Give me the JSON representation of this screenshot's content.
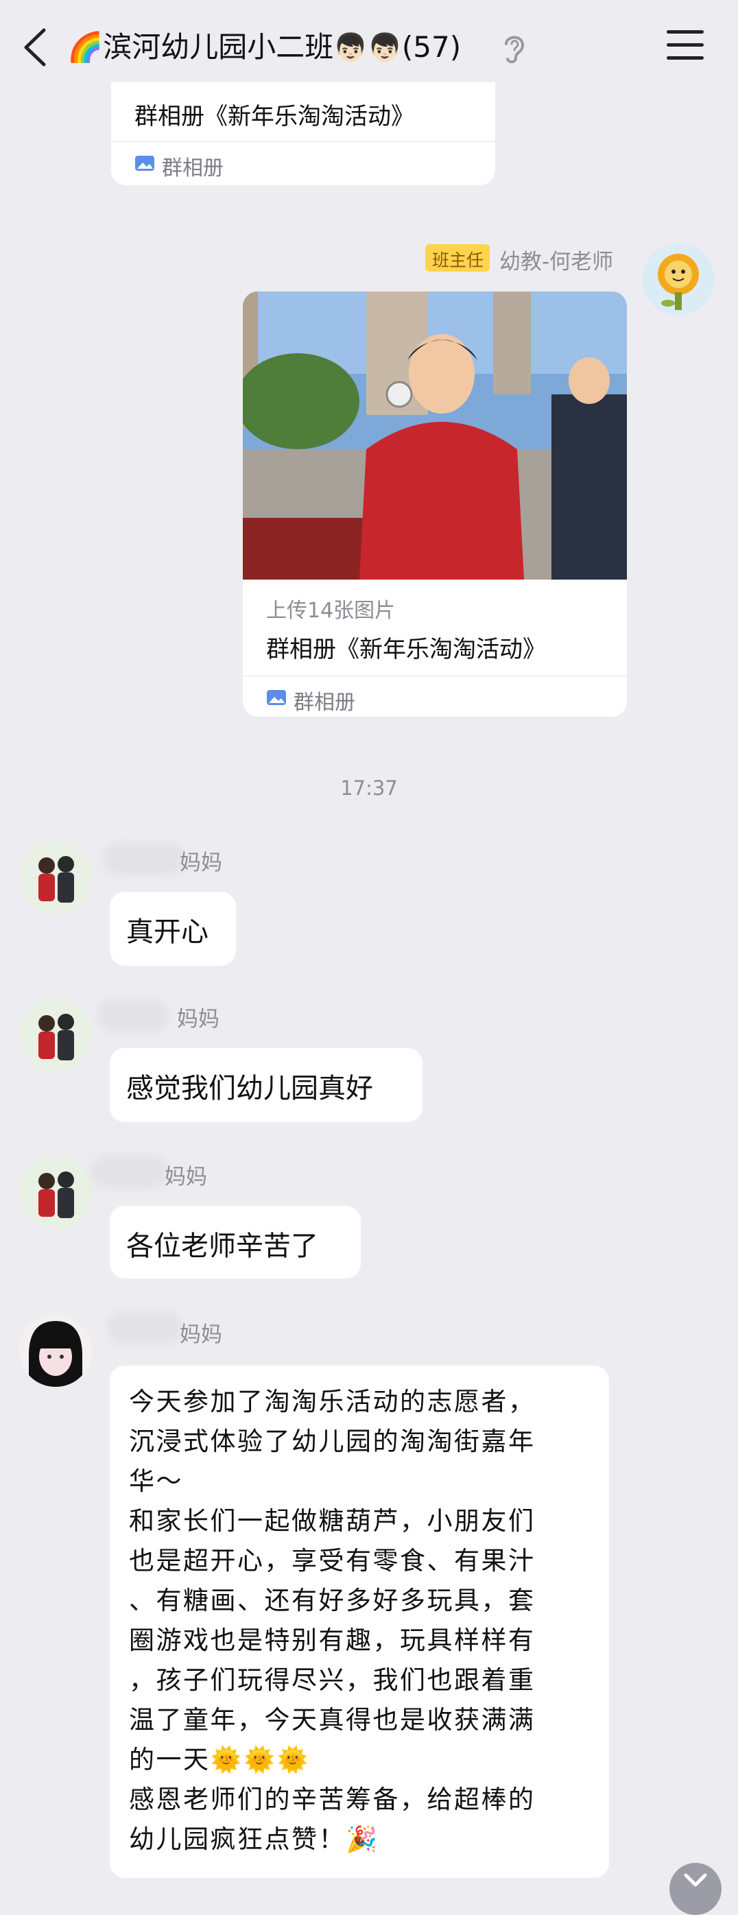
{
  "header": {
    "title": "🌈滨河幼儿园小二班",
    "member_count": "(57)",
    "back_icon": "chevron-left-icon",
    "ear_icon": "ear-icon",
    "menu_icon": "menu-icon"
  },
  "top_card": {
    "title": "群相册《新年乐淘淘活动》",
    "footer_label": "群相册"
  },
  "teacher_message": {
    "badge": "班主任",
    "sender": "幼教-何老师",
    "photo_desc_icon": "album-photo",
    "caption": "上传14张图片",
    "title": "群相册《新年乐淘淘活动》",
    "footer_label": "群相册"
  },
  "timestamp": "17:37",
  "messages": [
    {
      "name_tail": "妈妈",
      "text": "真开心"
    },
    {
      "name_tail": "妈妈",
      "text": "感觉我们幼儿园真好"
    },
    {
      "name_tail": "妈妈",
      "text": "各位老师辛苦了"
    },
    {
      "name_tail": "妈妈"
    }
  ],
  "long_message": {
    "lines": [
      "今天参加了淘淘乐活动的志愿者，",
      "沉浸式体验了幼儿园的淘淘街嘉年",
      "华～",
      "和家长们一起做糖葫芦，小朋友们",
      "也是超开心，享受有零食、有果汁",
      "、有糖画、还有好多好多玩具，套",
      "圈游戏也是特别有趣，玩具样样有",
      "，孩子们玩得尽兴，我们也跟着重",
      "温了童年，今天真得也是收获满满",
      "的一天🌞🌞🌞",
      "感恩老师们的辛苦筹备，给超棒的",
      "幼儿园疯狂点赞！🎉"
    ]
  },
  "colors": {
    "background": "#ededf1",
    "badge_bg": "#ffd34e",
    "badge_text": "#8a5a00",
    "muted": "#8d8d94"
  }
}
